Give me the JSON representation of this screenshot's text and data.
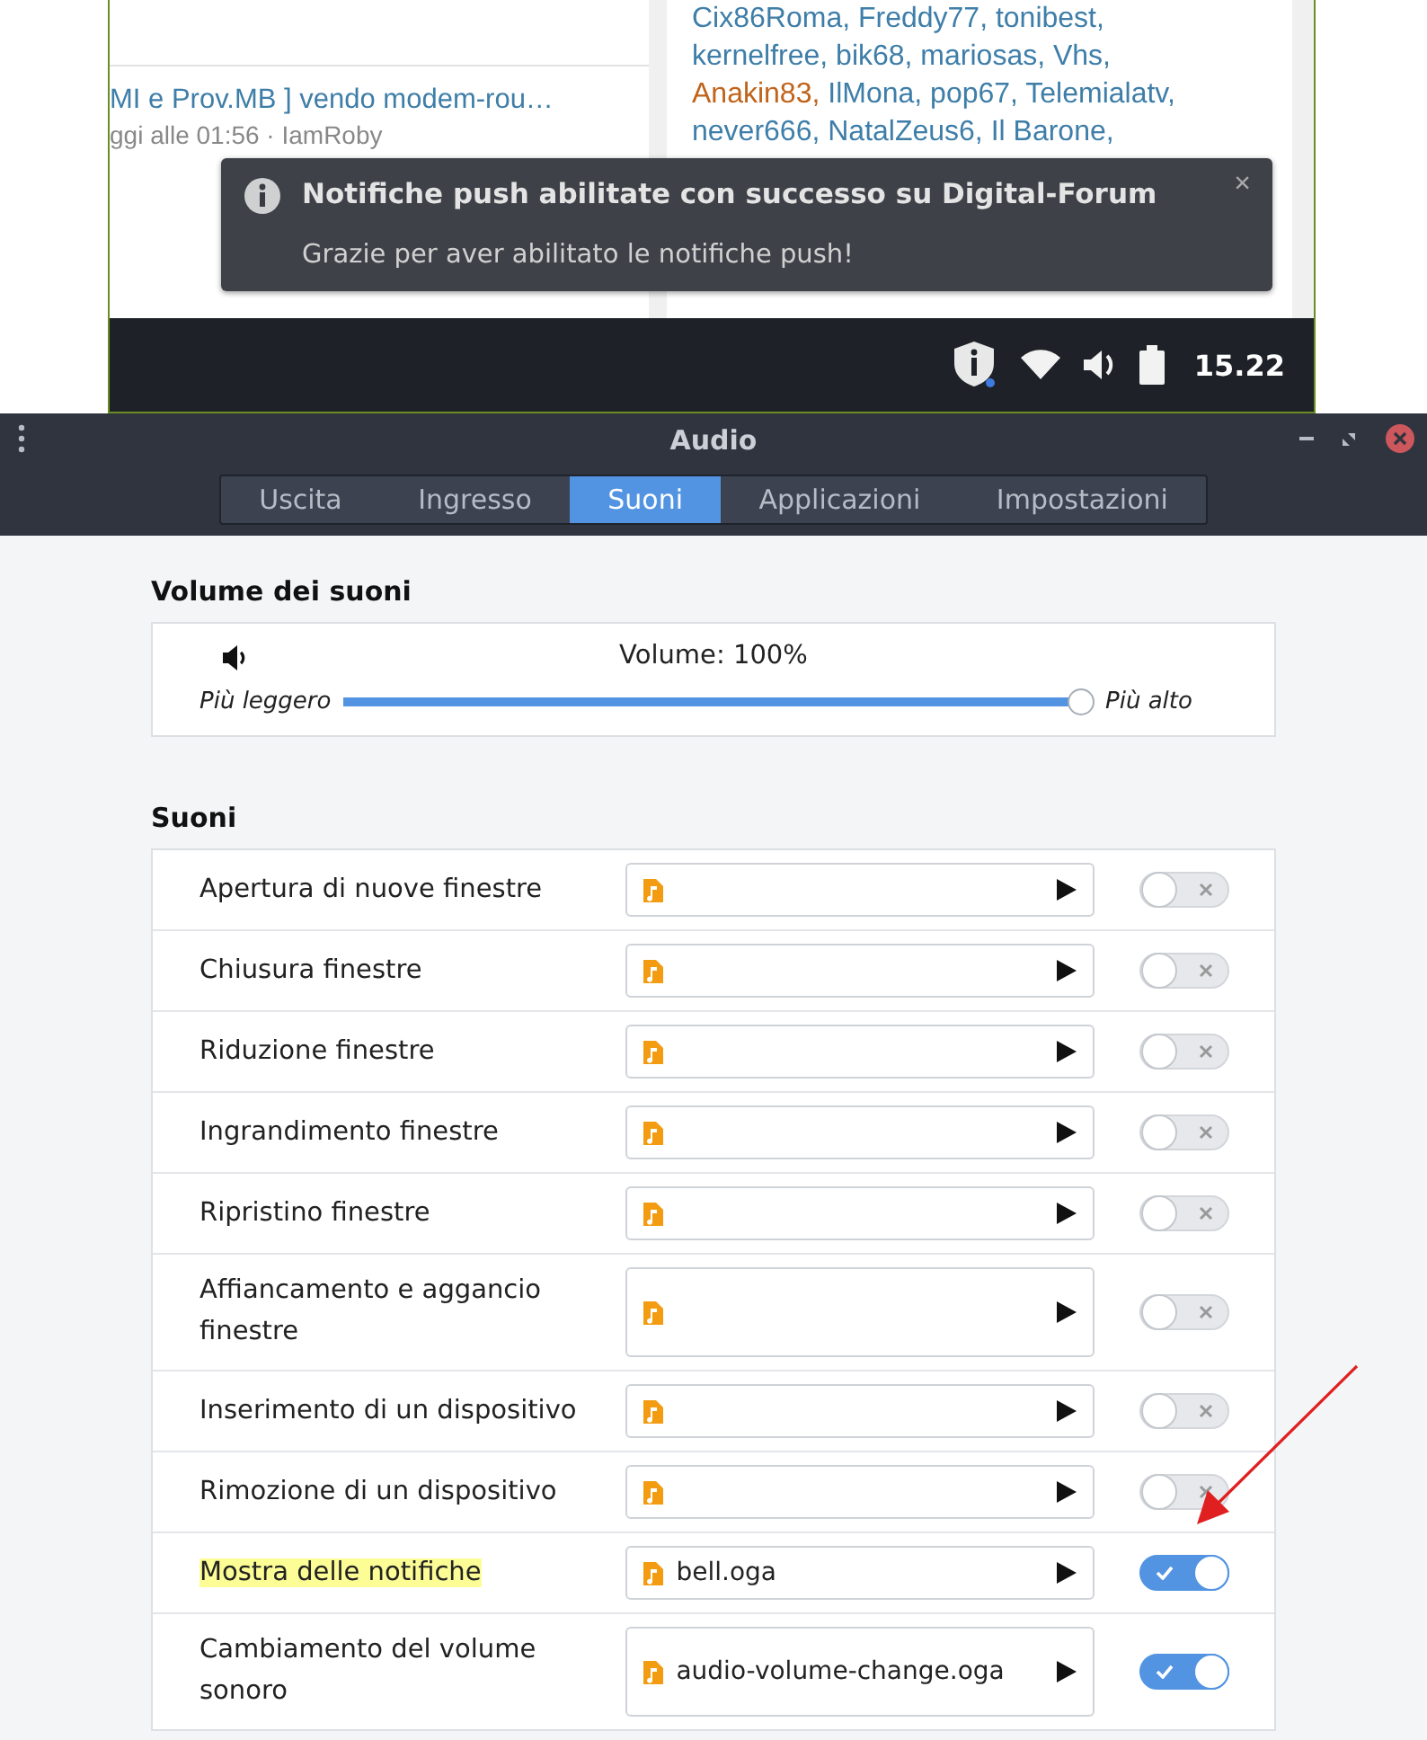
{
  "browser": {
    "topics": [
      {
        "title": "MI e Prov.MB ] vendo modem-rou…",
        "meta": "ggi alle 01:56 · IamRoby"
      }
    ],
    "online_users": [
      {
        "names": "Cix86Roma, Freddy77, tonibest,",
        "kind": "normal"
      },
      {
        "names": "kernelfree, bik68, mariosas, Vhs,",
        "kind": "normal"
      },
      {
        "names": "Anakin83,",
        "kind": "staff"
      },
      {
        "names": "IlMona, pop67, Telemialatv,",
        "kind": "normal"
      },
      {
        "names": "never666, NatalZeus6, Il Barone,",
        "kind": "normal"
      }
    ],
    "notification": {
      "title": "Notifiche push abilitate con successo su Digital-Forum",
      "body": "Grazie per aver abilitato le notifiche push!",
      "close": "×"
    }
  },
  "taskbar": {
    "clock": "15.22"
  },
  "window": {
    "title": "Audio"
  },
  "tabs": [
    {
      "label": "Uscita",
      "selected": false
    },
    {
      "label": "Ingresso",
      "selected": false
    },
    {
      "label": "Suoni",
      "selected": true
    },
    {
      "label": "Applicazioni",
      "selected": false
    },
    {
      "label": "Impostazioni",
      "selected": false
    }
  ],
  "volume": {
    "heading": "Volume dei suoni",
    "reading": "Volume: 100%",
    "low": "Più leggero",
    "high": "Più alto",
    "level": 1
  },
  "sounds": {
    "heading": "Suoni",
    "rows": [
      {
        "name": "Apertura di nuove finestre",
        "file": "",
        "on": false,
        "highlighted": false
      },
      {
        "name": "Chiusura finestre",
        "file": "",
        "on": false,
        "highlighted": false
      },
      {
        "name": "Riduzione finestre",
        "file": "",
        "on": false,
        "highlighted": false
      },
      {
        "name": "Ingrandimento finestre",
        "file": "",
        "on": false,
        "highlighted": false
      },
      {
        "name": "Ripristino finestre",
        "file": "",
        "on": false,
        "highlighted": false
      },
      {
        "name": "Affiancamento e aggancio finestre",
        "file": "",
        "on": false,
        "highlighted": false
      },
      {
        "name": "Inserimento di un dispositivo",
        "file": "",
        "on": false,
        "highlighted": false
      },
      {
        "name": "Rimozione di un dispositivo",
        "file": "",
        "on": false,
        "highlighted": false
      },
      {
        "name": "Mostra delle notifiche",
        "file": "bell.oga",
        "on": true,
        "highlighted": true
      },
      {
        "name": "Cambiamento del volume sonoro",
        "file": "audio-volume-change.oga",
        "on": true,
        "highlighted": false
      }
    ]
  }
}
